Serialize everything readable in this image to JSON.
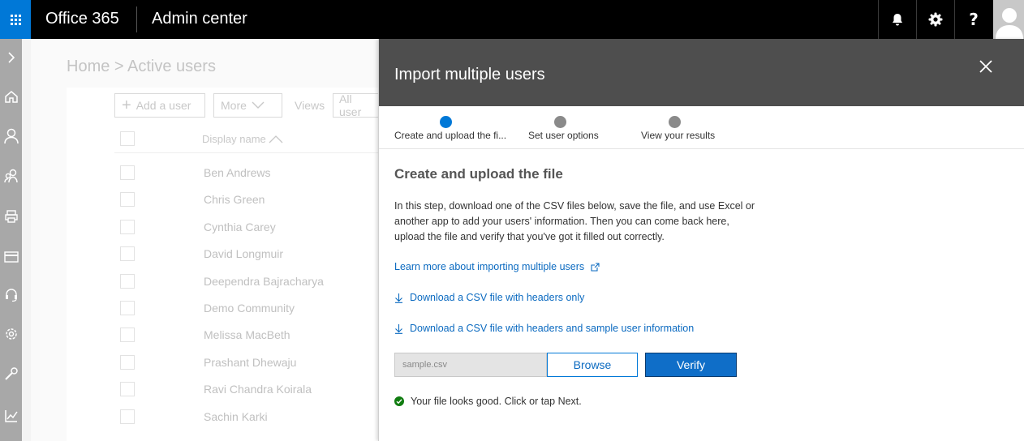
{
  "topbar": {
    "brand": "Office 365",
    "app_title": "Admin center"
  },
  "background": {
    "breadcrumb": "Home > Active users",
    "add_user": "Add a user",
    "more": "More",
    "views_label": "Views",
    "views_value": "All user",
    "column_display_name": "Display name",
    "users": [
      "Ben Andrews",
      "Chris Green",
      "Cynthia Carey",
      "David Longmuir",
      "Deependra Bajracharya",
      "Demo Community",
      "Melissa MacBeth",
      "Prashant Dhewaju",
      "Ravi Chandra Koirala",
      "Sachin Karki"
    ]
  },
  "panel": {
    "title": "Import multiple users",
    "steps": [
      {
        "label": "Create and upload the fi..."
      },
      {
        "label": "Set user options"
      },
      {
        "label": "View your results"
      }
    ],
    "active_step": 0,
    "section_title": "Create and upload the file",
    "description": "In this step, download one of the CSV files below, save the file, and use Excel or another app to add your users' information. Then you can come back here, upload the file and verify that you've got it filled out correctly.",
    "learn_more": "Learn more about importing multiple users",
    "download_headers": "Download a CSV file with headers only",
    "download_sample": "Download a CSV file with headers and sample user information",
    "file_value": "sample.csv",
    "browse": "Browse",
    "verify": "Verify",
    "status": "Your file looks good. Click or tap Next."
  },
  "colors": {
    "accent": "#0078d7",
    "panel_header": "#4e4e4e",
    "success": "#107c10"
  }
}
